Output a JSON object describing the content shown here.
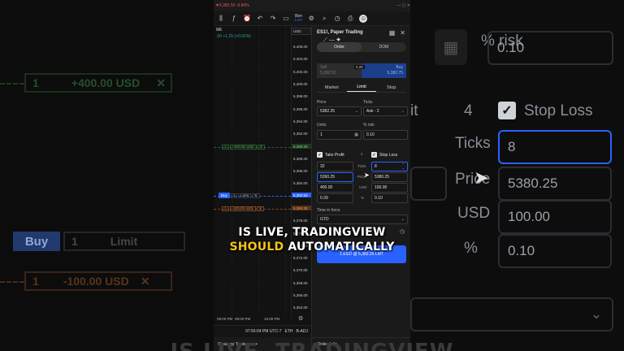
{
  "topbar": {
    "symbol": "▼5,382.50 -0.84%"
  },
  "toolbar": {
    "account_name": "Ben",
    "account_sub": "Live"
  },
  "chart": {
    "currency": "USD",
    "change_text": ".50 +1.25 (+0.02%)",
    "price_labels": [
      "5,406.00",
      "5,404.00",
      "5,402.00",
      "5,400.00",
      "5,398.00",
      "5,396.00",
      "5,394.00",
      "5,392.00",
      "5,390.00",
      "5,388.00",
      "5,386.00",
      "5,384.00",
      "5,382.00",
      "5,380.00",
      "5,378.00",
      "5,376.00",
      "5,374.00",
      "5,372.00",
      "5,370.00",
      "5,368.00",
      "5,366.00",
      "5,364.00"
    ],
    "tp_order": {
      "qty": "1",
      "amount": "+400.00 USD",
      "close": "✕"
    },
    "buy_order": {
      "side": "Buy",
      "qty": "1",
      "type": "Limit",
      "close": "✕"
    },
    "sl_order": {
      "qty": "1",
      "amount": "-100.00 USD",
      "close": "✕"
    },
    "price_tags": {
      "tp": "5,390.25",
      "current": "5,382.50",
      "sl": "5,380.25"
    },
    "time_labels": [
      "08:00 PM",
      "09:00 PM",
      "10:00 PM"
    ],
    "status_time": "07:56:04 PM UTC-7",
    "status_session": "ETH",
    "status_adj": "B-ADJ",
    "strategy_tab": "Strategy Tester",
    "strategy_more": "•••"
  },
  "panel": {
    "title": "ES1!, Paper Trading",
    "tabs": [
      "Order",
      "DOM"
    ],
    "sell_label": "Sell",
    "sell_price": "5,382.50",
    "spread": "0.25",
    "buy_label": "Buy",
    "buy_price": "5,382.75",
    "order_types": [
      "Market",
      "Limit",
      "Stop"
    ],
    "price_label": "Price",
    "price_value": "5382.25",
    "ticks_label": "Ticks",
    "ticks_value": "Ask - 2",
    "units_label": "Units",
    "units_value": "1",
    "risk_label": "% risk",
    "risk_value": "0.10",
    "take_profit_label": "Take Profit",
    "stop_loss_label": "Stop Loss",
    "tp_ticks": "32",
    "tp_price": "5390.25",
    "tp_usd": "400.00",
    "tp_pct": "0.39",
    "sl_ticks": "8",
    "sl_price": "5380.25",
    "sl_usd": "100.00",
    "sl_pct": "0.10",
    "mid_labels": [
      "4",
      "Ticks",
      "Price",
      "USD",
      "%"
    ],
    "tif_label": "Time in force",
    "tif_value": "GTD",
    "submit_label": "1 ES1! @ 5,382.25 LMT",
    "order_info": "Order Info"
  },
  "background": {
    "left_tp_qty": "1",
    "left_tp_amount": "+400.00 USD",
    "left_buy": "Buy",
    "left_buy_qty": "1",
    "left_buy_type": "Limit",
    "left_sl_qty": "1",
    "left_sl_amount": "-100.00 USD",
    "right_risk_label": "% risk",
    "right_risk_value": "0.10",
    "right_tick_num": "4",
    "right_stop_loss": "Stop Loss",
    "right_ticks": "Ticks",
    "right_ticks_value": "8",
    "right_price": "Price",
    "right_price_value": "5380.25",
    "right_usd": "USD",
    "right_usd_value": "100.00",
    "right_pct": "%",
    "right_pct_value": "0.10",
    "right_bit": "it"
  },
  "caption": {
    "line1": "IS LIVE, TRADINGVIEW",
    "line2_highlight": "SHOULD",
    "line2_rest": " AUTOMATICALLY",
    "bottom_partial": "IS LIVE, TRADINGVIEW"
  }
}
